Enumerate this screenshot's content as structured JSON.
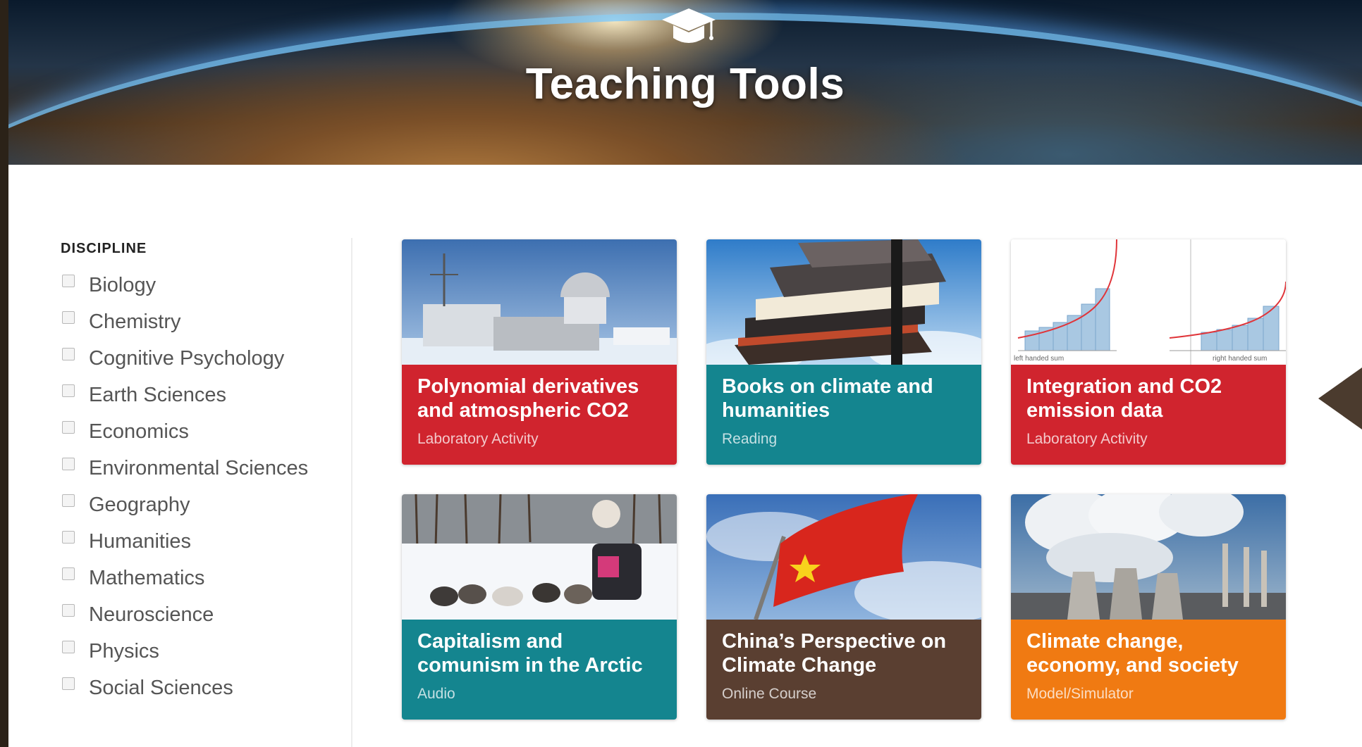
{
  "hero": {
    "title": "Teaching Tools",
    "icon": "graduation-cap-icon"
  },
  "sidebar": {
    "heading": "DISCIPLINE",
    "items": [
      {
        "label": "Biology",
        "checked": false
      },
      {
        "label": "Chemistry",
        "checked": false
      },
      {
        "label": "Cognitive Psychology",
        "checked": false
      },
      {
        "label": "Earth Sciences",
        "checked": false
      },
      {
        "label": "Economics",
        "checked": false
      },
      {
        "label": "Environmental Sciences",
        "checked": false
      },
      {
        "label": "Geography",
        "checked": false
      },
      {
        "label": "Humanities",
        "checked": false
      },
      {
        "label": "Mathematics",
        "checked": false
      },
      {
        "label": "Neuroscience",
        "checked": false
      },
      {
        "label": "Physics",
        "checked": false
      },
      {
        "label": "Social Sciences",
        "checked": false
      }
    ]
  },
  "cards": [
    {
      "title": "Polynomial derivatives and atmospheric CO2",
      "type": "Laboratory Activity",
      "color": "#d0242e"
    },
    {
      "title": "Books on climate and humanities",
      "type": "Reading",
      "color": "#14858f"
    },
    {
      "title": "Integration and CO2 emission data",
      "type": "Laboratory Activity",
      "color": "#d0242e"
    },
    {
      "title": "Capitalism and comunism in the Arctic",
      "type": "Audio",
      "color": "#14858f"
    },
    {
      "title": "China’s Perspective on Climate Change",
      "type": "Online Course",
      "color": "#5a3f31"
    },
    {
      "title": "Climate change, economy, and society",
      "type": "Model/Simulator",
      "color": "#f07a12"
    }
  ],
  "card3_image": {
    "left_caption": "left handed sum",
    "right_caption": "right handed sum"
  },
  "colors": {
    "accent_red": "#d0242e",
    "accent_teal": "#14858f",
    "accent_brown": "#5a3f31",
    "accent_orange": "#f07a12"
  },
  "arrow_icon": "triangle-left-icon"
}
